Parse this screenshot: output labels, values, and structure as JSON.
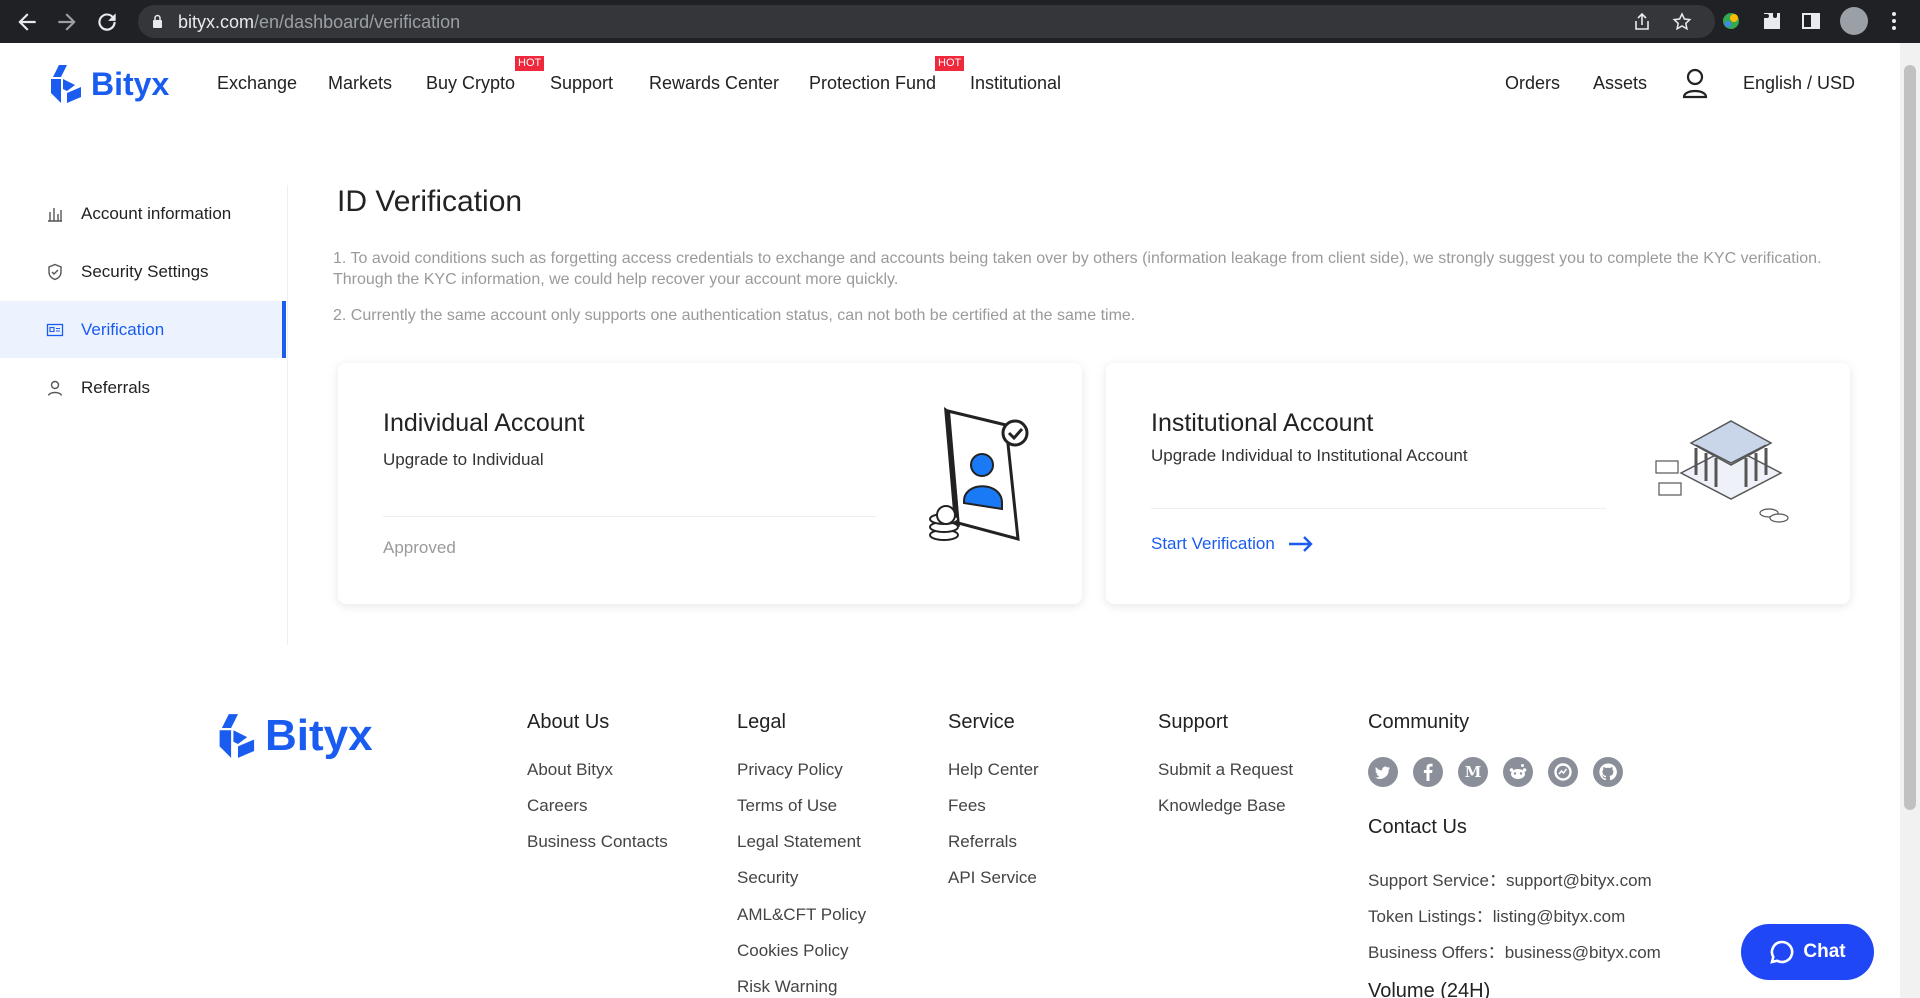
{
  "browser": {
    "url_host": "bityx.com",
    "url_path": "/en/dashboard/verification"
  },
  "header": {
    "logo_text": "Bityx",
    "nav": [
      {
        "label": "Exchange"
      },
      {
        "label": "Markets"
      },
      {
        "label": "Buy Crypto",
        "badge": "HOT"
      },
      {
        "label": "Support"
      },
      {
        "label": "Rewards Center"
      },
      {
        "label": "Protection Fund",
        "badge": "HOT"
      },
      {
        "label": "Institutional"
      }
    ],
    "right": {
      "orders": "Orders",
      "assets": "Assets",
      "language": "English / USD"
    }
  },
  "sidebar": {
    "items": [
      {
        "label": "Account information",
        "icon": "bar-chart-icon"
      },
      {
        "label": "Security Settings",
        "icon": "shield-icon"
      },
      {
        "label": "Verification",
        "icon": "id-card-icon",
        "active": true
      },
      {
        "label": "Referrals",
        "icon": "user-icon"
      }
    ]
  },
  "main": {
    "title": "ID Verification",
    "notes": [
      "1. To avoid conditions such as forgetting access credentials to exchange and accounts being taken over by others (information leakage from client side), we strongly suggest you to complete the KYC verification. Through the KYC information, we could help recover your account more quickly.",
      "2. Currently the same account only supports one authentication status, can not both be certified at the same time."
    ],
    "cards": [
      {
        "title": "Individual Account",
        "subtitle": "Upgrade to Individual",
        "status": "Approved"
      },
      {
        "title": "Institutional Account",
        "subtitle": "Upgrade Individual to Institutional Account",
        "action": "Start Verification"
      }
    ]
  },
  "footer": {
    "logo_text": "Bityx",
    "columns": [
      {
        "title": "About Us",
        "links": [
          "About Bityx",
          "Careers",
          "Business Contacts"
        ]
      },
      {
        "title": "Legal",
        "links": [
          "Privacy Policy",
          "Terms of Use",
          "Legal Statement",
          "Security",
          "AML&CFT Policy",
          "Cookies Policy",
          "Risk Warning"
        ]
      },
      {
        "title": "Service",
        "links": [
          "Help Center",
          "Fees",
          "Referrals",
          "API Service"
        ]
      },
      {
        "title": "Support",
        "links": [
          "Submit a Request",
          "Knowledge Base"
        ]
      }
    ],
    "community": {
      "title": "Community",
      "icons": [
        "twitter-icon",
        "facebook-icon",
        "medium-icon",
        "reddit-icon",
        "coinmarketcap-icon",
        "github-icon"
      ]
    },
    "contact": {
      "title": "Contact Us",
      "lines": [
        {
          "label": "Support Service：",
          "value": "support@bityx.com"
        },
        {
          "label": "Token Listings：",
          "value": "listing@bityx.com"
        },
        {
          "label": "Business Offers：",
          "value": "business@bityx.com"
        }
      ],
      "next_heading": "Volume (24H)"
    }
  },
  "chat": {
    "label": "Chat"
  },
  "colors": {
    "accent": "#1a5cf0",
    "hot": "#f0283c",
    "chat": "#1f47f5"
  }
}
